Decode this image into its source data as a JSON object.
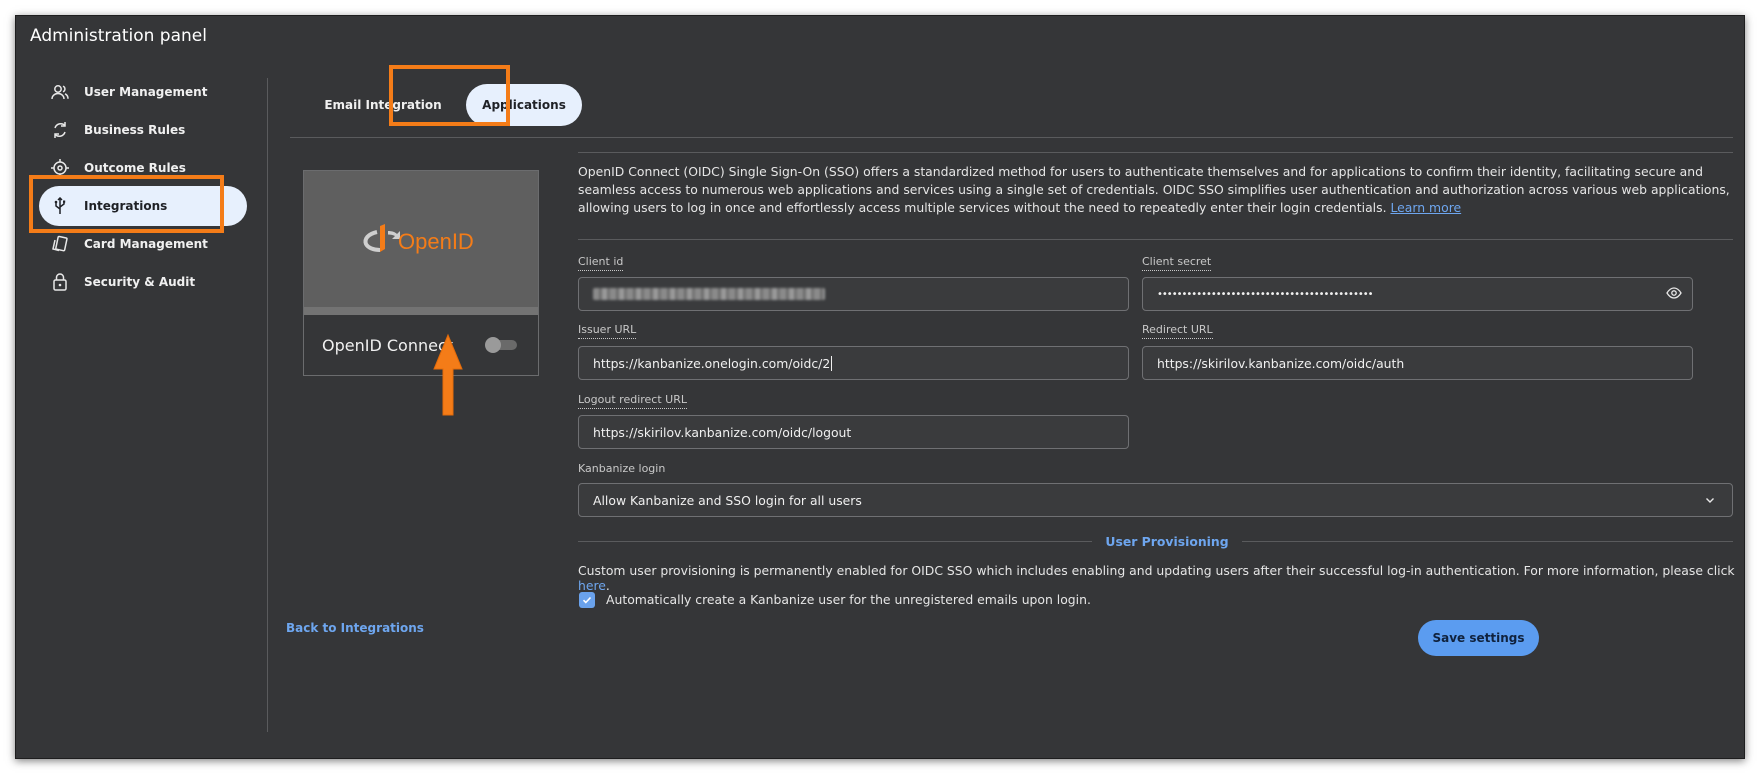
{
  "panel_title": "Administration panel",
  "sidebar": {
    "items": [
      {
        "label": "User Management",
        "icon": "users-icon"
      },
      {
        "label": "Business Rules",
        "icon": "refresh-icon"
      },
      {
        "label": "Outcome Rules",
        "icon": "target-icon"
      },
      {
        "label": "Integrations",
        "icon": "usb-icon",
        "active": true
      },
      {
        "label": "Card Management",
        "icon": "cards-icon"
      },
      {
        "label": "Security & Audit",
        "icon": "lock-icon"
      }
    ]
  },
  "tabs": [
    {
      "label": "Email Integration"
    },
    {
      "label": "Applications",
      "active": true
    }
  ],
  "app_card": {
    "logo_text": "OpenID",
    "name": "OpenID Connect",
    "enabled": false
  },
  "description": {
    "text": "OpenID Connect (OIDC) Single Sign-On (SSO) offers a standardized method for users to authenticate themselves and for applications to confirm their identity, facilitating secure and seamless access to numerous web applications and services using a single set of credentials. OIDC SSO simplifies user authentication and authorization across various web applications, allowing users to log in once and effortlessly access multiple services without the need to repeatedly enter their login credentials.",
    "learn_more": "Learn more"
  },
  "fields": {
    "client_id": {
      "label": "Client id"
    },
    "client_secret": {
      "label": "Client secret",
      "value": "••••••••••••••••••••••••••••••••••••••••••••"
    },
    "issuer_url": {
      "label": "Issuer URL",
      "value": "https://kanbanize.onelogin.com/oidc/2"
    },
    "redirect_url": {
      "label": "Redirect URL",
      "value": "https://skirilov.kanbanize.com/oidc/auth"
    },
    "logout_redirect_url": {
      "label": "Logout redirect URL",
      "value": "https://skirilov.kanbanize.com/oidc/logout"
    },
    "kanbanize_login": {
      "label": "Kanbanize login",
      "value": "Allow Kanbanize and SSO login for all users"
    }
  },
  "user_provisioning": {
    "title": "User Provisioning",
    "text": "Custom user provisioning is permanently enabled for OIDC SSO which includes enabling and updating users after their successful log-in authentication. For more information, please click ",
    "here": "here",
    "period": ".",
    "auto_create_label": "Automatically create a Kanbanize user for the unregistered emails upon login.",
    "auto_create_checked": true
  },
  "footer": {
    "back_label": "Back to Integrations",
    "save_label": "Save settings"
  },
  "colors": {
    "panel_bg": "#353638",
    "accent": "#5b9cf0",
    "active_bg": "#e7f0fd",
    "highlight": "#f47c18",
    "openid_orange": "#f47c18"
  }
}
